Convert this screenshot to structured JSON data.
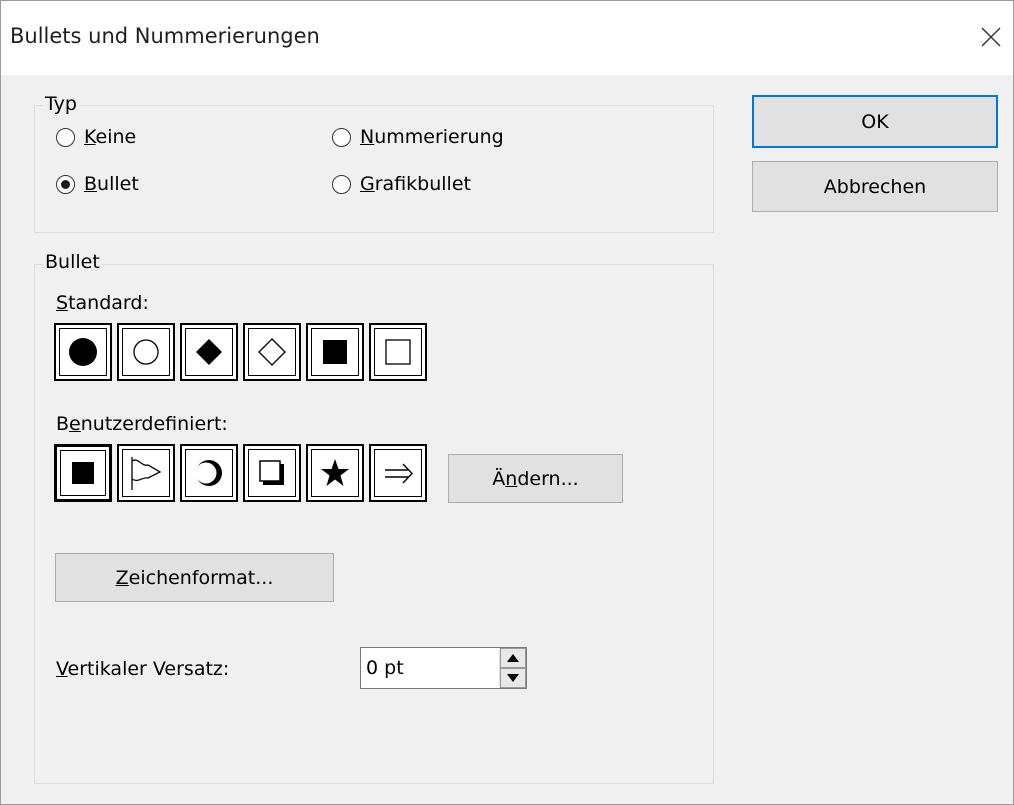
{
  "window": {
    "title": "Bullets und Nummerierungen",
    "close_icon": "close-icon"
  },
  "typ_group": {
    "label": "Typ",
    "options": [
      {
        "key": "K",
        "rest": "eine",
        "selected": false
      },
      {
        "key": "B",
        "rest": "ullet",
        "selected": true
      },
      {
        "key": "N",
        "rest": "ummerierung",
        "selected": false
      },
      {
        "key": "G",
        "rest": "rafikbullet",
        "selected": false
      }
    ]
  },
  "bullet_group": {
    "label": "Bullet",
    "standard_label": {
      "key": "S",
      "rest": "tandard:"
    },
    "standard_bullets": [
      "filled-circle-icon",
      "hollow-circle-icon",
      "filled-diamond-icon",
      "hollow-diamond-icon",
      "filled-square-icon",
      "hollow-square-icon"
    ],
    "custom_label": {
      "pre": "B",
      "key": "e",
      "rest": "nutzerdefiniert:"
    },
    "custom_bullets": [
      "filled-square-icon",
      "flag-icon",
      "crescent-circle-icon",
      "shadow-square-icon",
      "star-icon",
      "double-arrow-icon"
    ],
    "custom_selected_index": 0,
    "change_button": {
      "pre": "Ä",
      "key": "n",
      "rest": "dern..."
    },
    "char_format_button": {
      "key": "Z",
      "rest": "eichenformat..."
    },
    "offset_label": {
      "key": "V",
      "rest": "ertikaler Versatz:"
    },
    "offset_value": "0 pt"
  },
  "buttons": {
    "ok": "OK",
    "cancel": "Abbrechen"
  },
  "colors": {
    "dialog_bg": "#f0f0f0",
    "focus_border": "#0078d7",
    "button_bg": "#e1e1e1"
  }
}
